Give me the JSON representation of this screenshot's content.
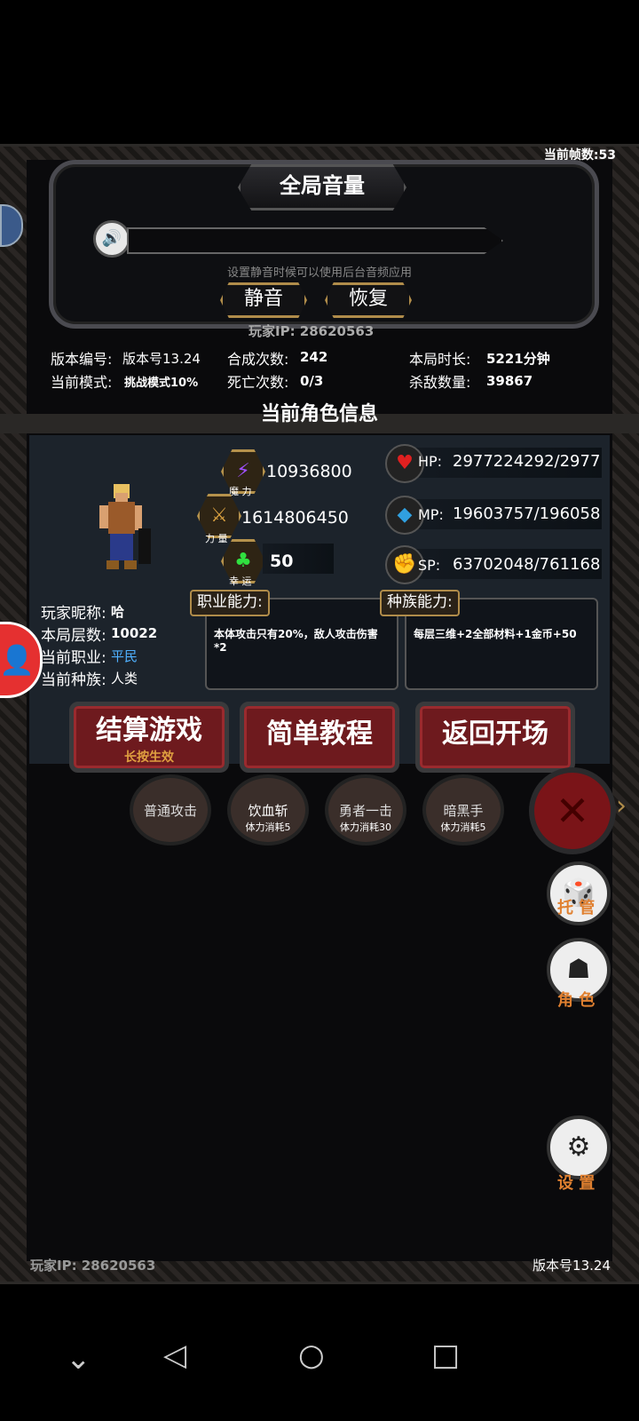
{
  "hud": {
    "fps": "当前帧数:53"
  },
  "volume": {
    "title": "全局音量",
    "hint": "设置静音时候可以使用后台音频应用",
    "mute_label": "静音",
    "restore_label": "恢复"
  },
  "player_ip": "玩家IP:  28620563",
  "stats": {
    "version_label": "版本编号:",
    "version_value": "版本号13.24",
    "craft_label": "合成次数:",
    "craft_value": "242",
    "time_label": "本局时长:",
    "time_value": "5221分钟",
    "mode_label": "当前模式:",
    "mode_value": "挑战模式10%",
    "death_label": "死亡次数:",
    "death_value": "0/3",
    "kills_label": "杀敌数量:",
    "kills_value": "39867"
  },
  "character": {
    "section_title": "当前角色信息",
    "magic_value": "10936800",
    "magic_label": "魔 力",
    "power_value": "1614806450",
    "power_label": "力 量",
    "luck_value": "50",
    "luck_label": "幸 运",
    "hp_label": "HP:",
    "hp_value": "2977224292/2977",
    "mp_label": "MP:",
    "mp_value": "19603757/196058",
    "sp_label": "SP:",
    "sp_value": "63702048/761168",
    "nickname_label": "玩家昵称:",
    "nickname_value": "哈",
    "floor_label": "本局层数:",
    "floor_value": "10022",
    "job_label": "当前职业:",
    "job_value": "平民",
    "race_label": "当前种族:",
    "race_value": "人类",
    "job_ability_label": "职业能力:",
    "job_ability_text": "本体攻击只有20%，敌人攻击伤害*2",
    "race_ability_label": "种族能力:",
    "race_ability_text": "每层三维+2全部材料+1金币+50"
  },
  "actions": {
    "settle_label": "结算游戏",
    "settle_sub": "长按生效",
    "tutorial_label": "简单教程",
    "return_label": "返回开场"
  },
  "skills": [
    {
      "name": "普通攻击",
      "cost": ""
    },
    {
      "name": "饮血斩",
      "cost": "体力消耗5"
    },
    {
      "name": "勇者一击",
      "cost": "体力消耗30"
    },
    {
      "name": "暗黑手",
      "cost": "体力消耗5"
    }
  ],
  "side": {
    "auto_label": "托 管",
    "role_label": "角 色",
    "settings_label": "设 置"
  },
  "footer": {
    "ip": "玩家IP:  28620563",
    "version": "版本号13.24"
  },
  "colors": {
    "accent_gold": "#b08c4a",
    "job_blue": "#4fb0ff",
    "side_orange": "#e08030",
    "button_red": "#6e1a1e"
  }
}
